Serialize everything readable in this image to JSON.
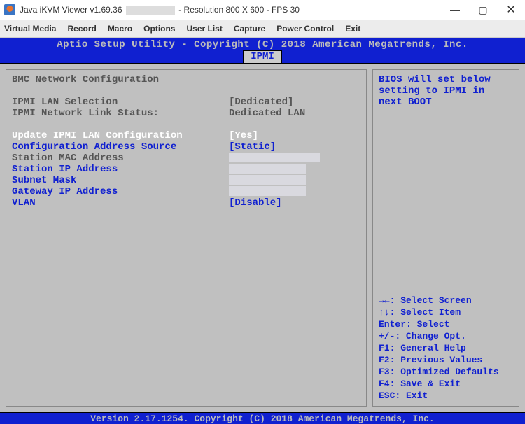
{
  "window": {
    "title_prefix": "Java iKVM Viewer v1.69.36 ",
    "title_suffix": " - Resolution 800 X 600 - FPS 30",
    "controls": {
      "min": "—",
      "max": "▢",
      "close": "✕"
    }
  },
  "menubar": [
    "Virtual Media",
    "Record",
    "Macro",
    "Options",
    "User List",
    "Capture",
    "Power Control",
    "Exit"
  ],
  "bios": {
    "header": "Aptio Setup Utility - Copyright (C) 2018 American Megatrends, Inc.",
    "tab": "IPMI",
    "footer": "Version 2.17.1254. Copyright (C) 2018 American Megatrends, Inc.",
    "section_title": "BMC Network Configuration",
    "rows": {
      "ipmi_lan_sel": {
        "label": "IPMI LAN Selection",
        "value": "[Dedicated]"
      },
      "ipmi_link": {
        "label": "IPMI Network Link Status:",
        "value": "Dedicated LAN"
      },
      "update_lan": {
        "label": "Update IPMI LAN Configuration",
        "value": "[Yes]"
      },
      "addr_src": {
        "label": "Configuration Address Source",
        "value": "[Static]"
      },
      "station_mac": {
        "label": "Station MAC Address",
        "value": ""
      },
      "station_ip": {
        "label": "Station IP Address",
        "value": ""
      },
      "subnet": {
        "label": "Subnet Mask",
        "value": ""
      },
      "gateway": {
        "label": "Gateway IP Address",
        "value": ""
      },
      "vlan": {
        "label": "VLAN",
        "value": "[Disable]"
      }
    },
    "help_top": "BIOS will set below setting to IPMI in next BOOT",
    "help_bottom": [
      "→←: Select Screen",
      "↑↓: Select Item",
      "Enter: Select",
      "+/-: Change Opt.",
      "F1: General Help",
      "F2: Previous Values",
      "F3: Optimized Defaults",
      "F4: Save & Exit",
      "ESC: Exit"
    ]
  }
}
